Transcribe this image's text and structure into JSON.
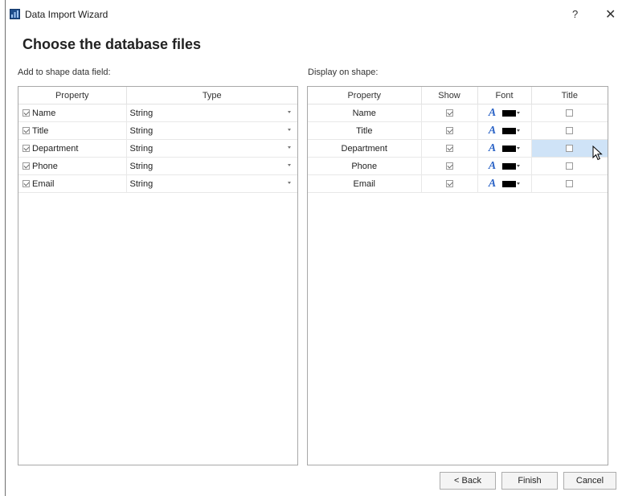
{
  "window": {
    "title": "Data Import Wizard",
    "help": "?",
    "close": "✕"
  },
  "heading": "Choose the database files",
  "left": {
    "label": "Add to shape data field:",
    "headers": {
      "property": "Property",
      "type": "Type"
    },
    "rows": [
      {
        "name": "Name",
        "checked": true,
        "type": "String"
      },
      {
        "name": "Title",
        "checked": true,
        "type": "String"
      },
      {
        "name": "Department",
        "checked": true,
        "type": "String"
      },
      {
        "name": "Phone",
        "checked": true,
        "type": "String"
      },
      {
        "name": "Email",
        "checked": true,
        "type": "String"
      }
    ]
  },
  "right": {
    "label": "Display on shape:",
    "headers": {
      "property": "Property",
      "show": "Show",
      "font": "Font",
      "title": "Title"
    },
    "rows": [
      {
        "name": "Name",
        "show": true,
        "font_glyph": "A",
        "font_color": "#000000",
        "title": false
      },
      {
        "name": "Title",
        "show": true,
        "font_glyph": "A",
        "font_color": "#000000",
        "title": false
      },
      {
        "name": "Department",
        "show": true,
        "font_glyph": "A",
        "font_color": "#000000",
        "title": false
      },
      {
        "name": "Phone",
        "show": true,
        "font_glyph": "A",
        "font_color": "#000000",
        "title": false
      },
      {
        "name": "Email",
        "show": true,
        "font_glyph": "A",
        "font_color": "#000000",
        "title": false
      }
    ],
    "highlighted_row": 2
  },
  "buttons": {
    "back": "< Back",
    "finish": "Finish",
    "cancel": "Cancel"
  },
  "colors": {
    "font_glyph": "#2b63c6",
    "selection": "#cfe3f7",
    "app_icon": "#1f4e8c"
  }
}
